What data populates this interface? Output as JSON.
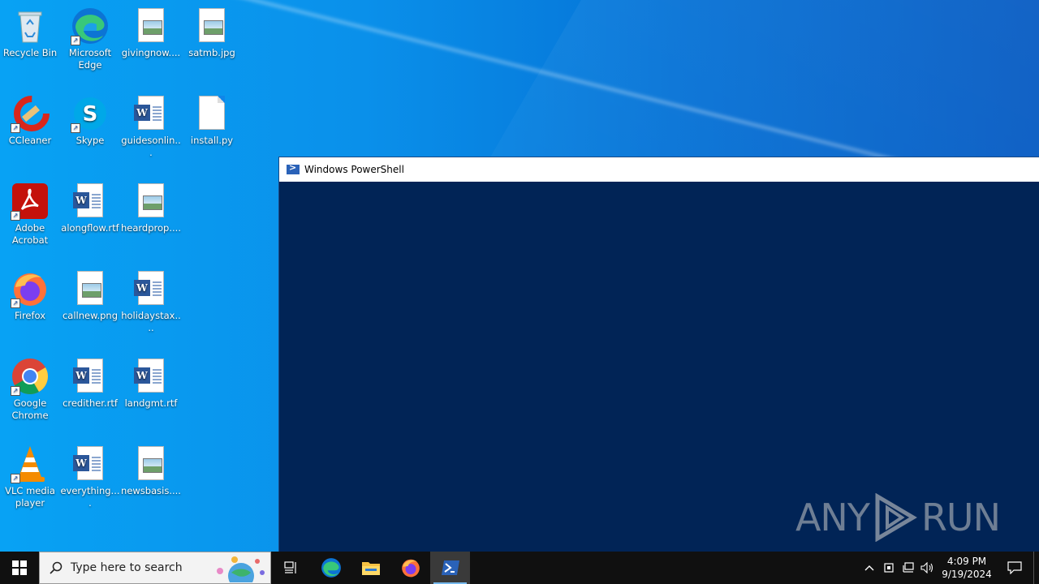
{
  "desktop": {
    "icons": [
      {
        "label": "Recycle Bin",
        "icon": "recycle-bin-icon"
      },
      {
        "label": "Microsoft Edge",
        "icon": "edge-icon"
      },
      {
        "label": "givingnow....",
        "icon": "image-file-icon"
      },
      {
        "label": "satmb.jpg",
        "icon": "image-file-icon"
      },
      {
        "label": "CCleaner",
        "icon": "ccleaner-icon"
      },
      {
        "label": "Skype",
        "icon": "skype-icon"
      },
      {
        "label": "guidesonlin...",
        "icon": "word-doc-icon"
      },
      {
        "label": "install.py",
        "icon": "blank-file-icon"
      },
      {
        "label": "Adobe Acrobat",
        "icon": "acrobat-icon"
      },
      {
        "label": "alongflow.rtf",
        "icon": "word-doc-icon"
      },
      {
        "label": "heardprop....",
        "icon": "image-file-icon"
      },
      {
        "label": "Firefox",
        "icon": "firefox-icon"
      },
      {
        "label": "callnew.png",
        "icon": "image-file-icon"
      },
      {
        "label": "holidaystax....",
        "icon": "word-doc-icon"
      },
      {
        "label": "Google Chrome",
        "icon": "chrome-icon"
      },
      {
        "label": "credither.rtf",
        "icon": "word-doc-icon"
      },
      {
        "label": "landgmt.rtf",
        "icon": "word-doc-icon"
      },
      {
        "label": "VLC media player",
        "icon": "vlc-icon"
      },
      {
        "label": "everything....",
        "icon": "word-doc-icon"
      },
      {
        "label": "newsbasis....",
        "icon": "image-file-icon"
      }
    ]
  },
  "window": {
    "title": "Windows PowerShell",
    "background": "#012456"
  },
  "watermark": {
    "left": "ANY",
    "right": "RUN"
  },
  "taskbar": {
    "search_placeholder": "Type here to search",
    "apps": [
      "task-view",
      "edge",
      "file-explorer",
      "firefox",
      "powershell"
    ],
    "active_app": "powershell",
    "clock_time": "4:09 PM",
    "clock_date": "9/19/2024"
  }
}
